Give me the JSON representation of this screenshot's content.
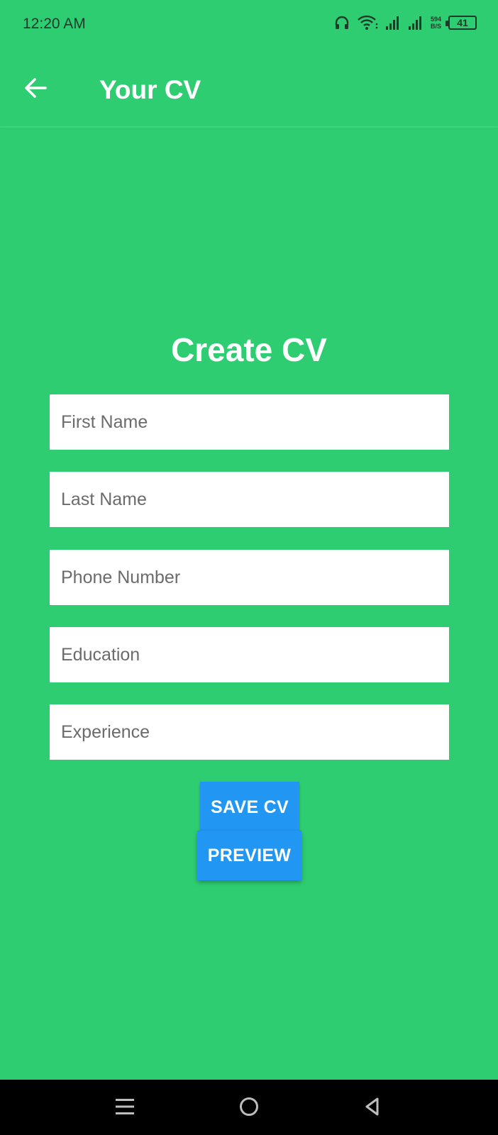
{
  "status_bar": {
    "time": "12:20 AM",
    "net_speed_value": "594",
    "net_speed_unit": "B/S",
    "battery_level": "41",
    "icons": [
      "headphones-icon",
      "wifi-icon",
      "signal-icon",
      "signal-icon",
      "battery-icon"
    ]
  },
  "app_bar": {
    "title": "Your CV",
    "back_icon": "arrow-left-icon"
  },
  "form": {
    "heading": "Create CV",
    "first_name_placeholder": "First Name",
    "last_name_placeholder": "Last Name",
    "phone_placeholder": "Phone Number",
    "education_placeholder": "Education",
    "experience_placeholder": "Experience",
    "save_label": "SAVE CV",
    "preview_label": "PREVIEW"
  },
  "nav_bar": {
    "icons": [
      "menu-icon",
      "home-icon",
      "back-triangle-icon"
    ]
  },
  "colors": {
    "background": "#2fcd72",
    "button": "#2196f3",
    "field": "#ffffff",
    "nav_bar": "#000000"
  }
}
